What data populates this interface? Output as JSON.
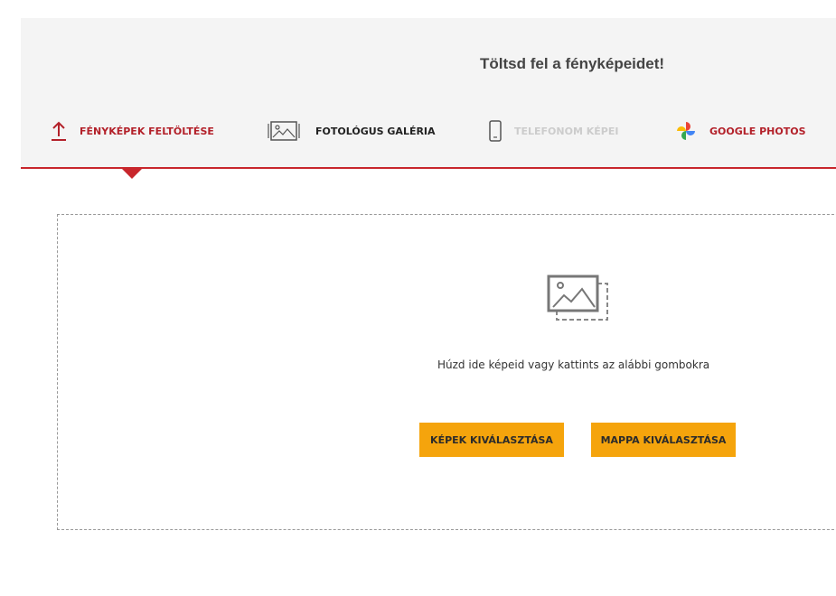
{
  "header": {
    "title": "Töltsd fel a fényképeidet!"
  },
  "tabs": [
    {
      "label": "FÉNYKÉPEK FELTÖLTÉSE",
      "icon": "upload-icon",
      "state": "active",
      "color": "#b3212a"
    },
    {
      "label": "FOTOLÓGUS GALÉRIA",
      "icon": "gallery-icon",
      "state": "normal",
      "color": "#222222"
    },
    {
      "label": "TELEFONOM KÉPEI",
      "icon": "phone-icon",
      "state": "disabled",
      "color": "#cccccc"
    },
    {
      "label": "GOOGLE PHOTOS",
      "icon": "google-photos-icon",
      "state": "normal",
      "color": "#b3212a"
    }
  ],
  "dropzone": {
    "icon": "image-placeholder-icon",
    "instruction": "Húzd ide képeid vagy kattints az alábbi gombokra",
    "buttons": {
      "select_images": "KÉPEK KIVÁLASZTÁSA",
      "select_folder": "MAPPA KIVÁLASZTÁSA"
    }
  },
  "colors": {
    "accent": "#c8262c",
    "button": "#f5a40c",
    "header_bg": "#f4f4f4"
  }
}
